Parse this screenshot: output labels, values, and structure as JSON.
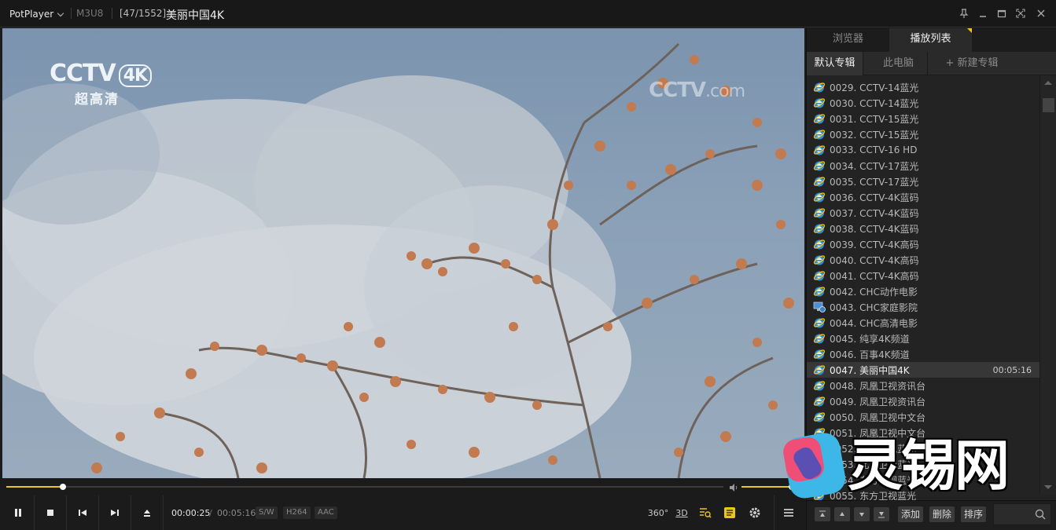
{
  "titlebar": {
    "app_name": "PotPlayer",
    "format": "M3U8",
    "counter": "[47/1552]",
    "title": "美丽中国4K"
  },
  "video": {
    "logo_text": "CCTV",
    "logo_badge": "4K",
    "logo_sub": "超高清",
    "watermark": "CCTV",
    "watermark_suffix": ".com"
  },
  "playback": {
    "current_time": "00:00:25",
    "separator": "/",
    "total_time": "00:05:16",
    "progress": 0.0791,
    "volume": 1.0,
    "tags": [
      "S/W",
      "H264",
      "AAC"
    ],
    "label_360": "360°",
    "label_3d": "3D"
  },
  "panel": {
    "tabs": [
      "浏览器",
      "播放列表"
    ],
    "sub_tabs": [
      "默认专辑",
      "此电脑",
      "+ 新建专辑"
    ],
    "items": [
      {
        "label": "0029. CCTV-14蓝光",
        "icon": "ie-icon"
      },
      {
        "label": "0030. CCTV-14蓝光",
        "icon": "ie-icon"
      },
      {
        "label": "0031. CCTV-15蓝光",
        "icon": "ie-icon"
      },
      {
        "label": "0032. CCTV-15蓝光",
        "icon": "ie-icon"
      },
      {
        "label": "0033. CCTV-16 HD",
        "icon": "ie-icon"
      },
      {
        "label": "0034. CCTV-17蓝光",
        "icon": "ie-icon"
      },
      {
        "label": "0035. CCTV-17蓝光",
        "icon": "ie-icon"
      },
      {
        "label": "0036. CCTV-4K蓝码",
        "icon": "ie-icon"
      },
      {
        "label": "0037. CCTV-4K蓝码",
        "icon": "ie-icon"
      },
      {
        "label": "0038. CCTV-4K蓝码",
        "icon": "ie-icon"
      },
      {
        "label": "0039. CCTV-4K高码",
        "icon": "ie-icon"
      },
      {
        "label": "0040. CCTV-4K高码",
        "icon": "ie-icon"
      },
      {
        "label": "0041. CCTV-4K高码",
        "icon": "ie-icon"
      },
      {
        "label": "0042. CHC动作电影",
        "icon": "ie-icon"
      },
      {
        "label": "0043. CHC家庭影院",
        "icon": "network-icon"
      },
      {
        "label": "0044. CHC高清电影",
        "icon": "ie-icon"
      },
      {
        "label": "0045. 纯享4K频道",
        "icon": "ie-icon"
      },
      {
        "label": "0046. 百事4K频道",
        "icon": "ie-icon"
      },
      {
        "label": "0047. 美丽中国4K",
        "icon": "ie-icon",
        "selected": true,
        "duration": "00:05:16"
      },
      {
        "label": "0048. 凤凰卫视资讯台",
        "icon": "ie-icon"
      },
      {
        "label": "0049. 凤凰卫视资讯台",
        "icon": "ie-icon"
      },
      {
        "label": "0050. 凤凰卫视中文台",
        "icon": "ie-icon"
      },
      {
        "label": "0051. 凤凰卫视中文台",
        "icon": "ie-icon"
      },
      {
        "label": "0052. 北京卫视蓝光",
        "icon": "ie-icon"
      },
      {
        "label": "0053. 北京卫视蓝光",
        "icon": "ie-icon"
      },
      {
        "label": "0054. 东方卫视蓝光",
        "icon": "ie-icon"
      },
      {
        "label": "0055. 东方卫视蓝光",
        "icon": "ie-icon"
      }
    ],
    "footer_buttons": [
      "添加",
      "删除",
      "排序"
    ]
  },
  "overlay": {
    "brand_text": "灵锡网"
  },
  "colors": {
    "accent": "#e9c61c",
    "selected_row": "#373737",
    "panel_bg": "#232323"
  }
}
